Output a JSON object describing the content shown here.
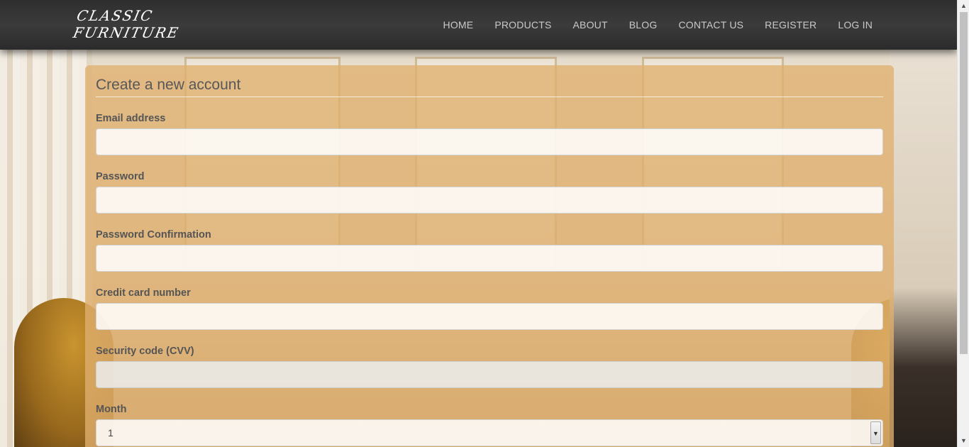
{
  "header": {
    "logo_line1": "CLASSIC",
    "logo_line2": "FURNITURE",
    "nav": [
      "HOME",
      "PRODUCTS",
      "ABOUT",
      "BLOG",
      "CONTACT US",
      "REGISTER",
      "LOG IN"
    ]
  },
  "form": {
    "title": "Create a new account",
    "email_label": "Email address",
    "email_value": "",
    "password_label": "Password",
    "password_value": "",
    "password_confirmation_label": "Password Confirmation",
    "password_confirmation_value": "",
    "credit_card_label": "Credit card number",
    "credit_card_value": "",
    "cvv_label": "Security code (CVV)",
    "cvv_value": "",
    "month_label": "Month",
    "month_value": "1"
  },
  "colors": {
    "header_bg": "#333333",
    "nav_text": "#c9c9c9",
    "panel_bg": "#e0af6e",
    "label_text": "#555555"
  },
  "icons": {
    "select_arrow": "chevron-down-icon",
    "scroll_up": "arrow-up-icon",
    "scroll_down": "arrow-down-icon"
  }
}
